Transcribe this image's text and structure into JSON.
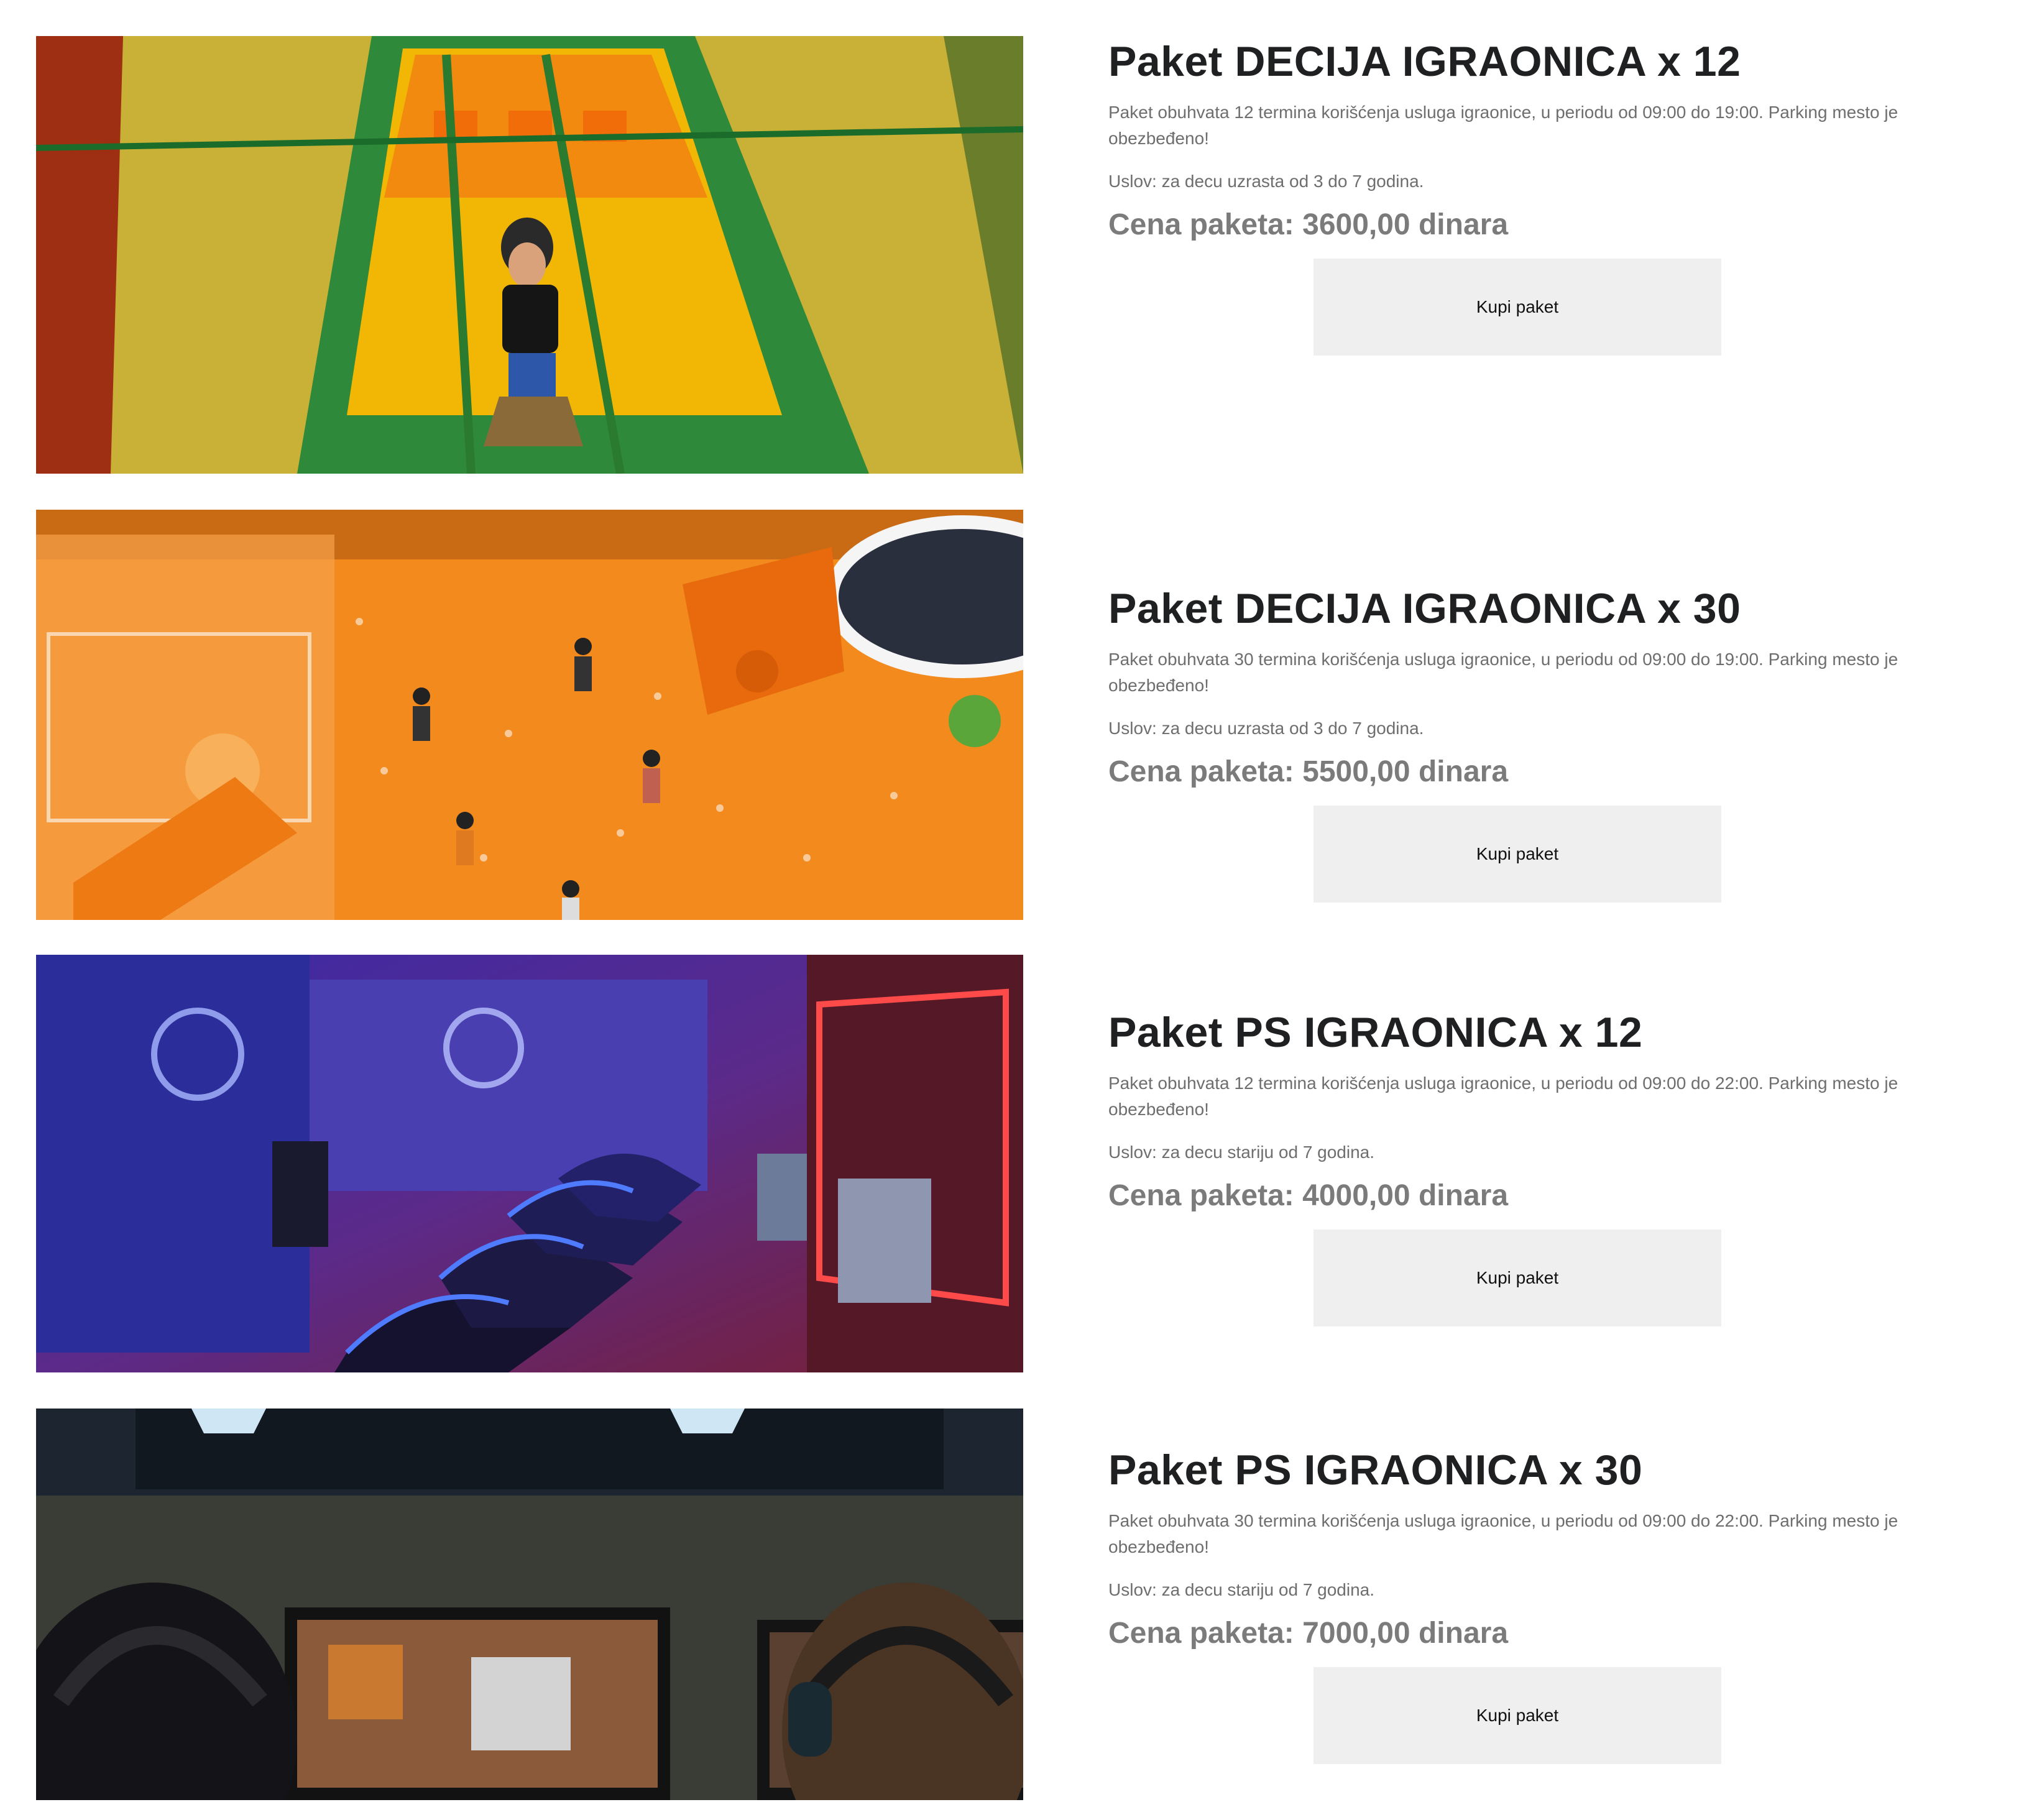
{
  "packages": [
    {
      "title": "Paket DECIJA IGRAONICA x 12",
      "description": "Paket obuhvata 12 termina korišćenja usluga igraonice, u periodu od 09:00 do 19:00. Parking mesto je obezbeđeno!",
      "condition": "Uslov: za decu uzrasta od 3 do 7 godina.",
      "price": "Cena paketa: 3600,00 dinara",
      "button_label": "Kupi paket",
      "image_subject": "child-on-slide-photo"
    },
    {
      "title": "Paket DECIJA IGRAONICA x 30",
      "description": "Paket obuhvata 30 termina korišćenja usluga igraonice, u periodu od 09:00 do 19:00. Parking mesto je obezbeđeno!",
      "condition": "Uslov: za decu uzrasta od 3 do 7 godina.",
      "price": "Cena paketa: 5500,00 dinara",
      "button_label": "Kupi paket",
      "image_subject": "ball-pit-photo"
    },
    {
      "title": "Paket PS IGRAONICA x 12",
      "description": "Paket obuhvata 12 termina korišćenja usluga igraonice, u periodu od 09:00 do 22:00. Parking mesto je obezbeđeno!",
      "condition": "Uslov: za decu stariju od 7 godina.",
      "price": "Cena paketa: 4000,00 dinara",
      "button_label": "Kupi paket",
      "image_subject": "gaming-arena-photo"
    },
    {
      "title": "Paket PS IGRAONICA x 30",
      "description": "Paket obuhvata 30 termina korišćenja usluga igraonice, u periodu od 09:00 do 22:00. Parking mesto je obezbeđeno!",
      "condition": "Uslov: za decu stariju od 7 godina.",
      "price": "Cena paketa: 7000,00 dinara",
      "button_label": "Kupi paket",
      "image_subject": "gamers-at-monitors-photo"
    }
  ],
  "colors": {
    "title": "#1f2022",
    "body_text": "#6e6e6e",
    "price": "#7b7b7b",
    "button_bg": "#efefef",
    "page_bg": "#ffffff"
  }
}
